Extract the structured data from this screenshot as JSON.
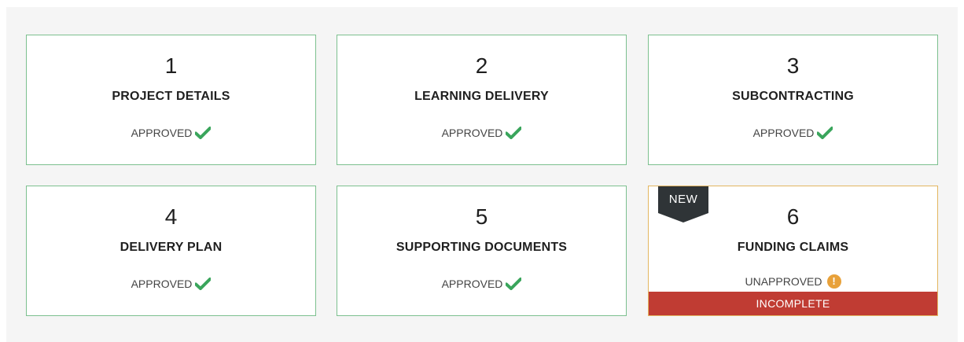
{
  "cards": [
    {
      "number": "1",
      "title": "PROJECT DETAILS",
      "status": "APPROVED",
      "status_icon": "check-icon"
    },
    {
      "number": "2",
      "title": "LEARNING DELIVERY",
      "status": "APPROVED",
      "status_icon": "check-icon"
    },
    {
      "number": "3",
      "title": "SUBCONTRACTING",
      "status": "APPROVED",
      "status_icon": "check-icon"
    },
    {
      "number": "4",
      "title": "DELIVERY PLAN",
      "status": "APPROVED",
      "status_icon": "check-icon"
    },
    {
      "number": "5",
      "title": "SUPPORTING DOCUMENTS",
      "status": "APPROVED",
      "status_icon": "check-icon"
    },
    {
      "number": "6",
      "title": "FUNDING CLAIMS",
      "status": "UNAPPROVED",
      "status_icon": "alert-icon",
      "badge": "NEW",
      "footer": "INCOMPLETE",
      "alert_glyph": "!"
    }
  ],
  "colors": {
    "approved_border": "#7cc08f",
    "check": "#3aa55c",
    "warn_border": "#e3b660",
    "alert": "#e8a13a",
    "badge": "#2f3437",
    "incomplete": "#c03c33"
  }
}
